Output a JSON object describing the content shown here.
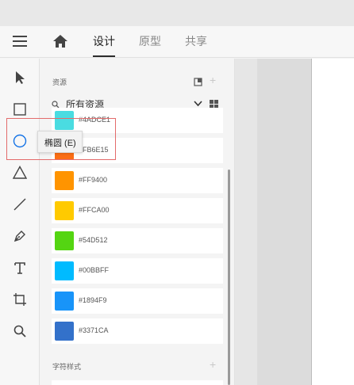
{
  "topbar": {
    "tabs": [
      {
        "label": "设计",
        "active": true
      },
      {
        "label": "原型",
        "active": false
      },
      {
        "label": "共享",
        "active": false
      }
    ]
  },
  "toolbar": {
    "tools": [
      "select-tool",
      "rectangle-tool",
      "ellipse-tool",
      "polygon-tool",
      "line-tool",
      "pen-tool",
      "text-tool",
      "artboard-tool",
      "zoom-tool"
    ],
    "active_tool": "ellipse-tool",
    "accent_color": "#1473e6"
  },
  "tooltip": {
    "text": "椭圆 (E)"
  },
  "assets_panel": {
    "title": "资源",
    "filter_label": "所有资源",
    "colors": [
      {
        "label": "#4ADCE1",
        "hex": "#4ADCE1"
      },
      {
        "label": "#FB6E15",
        "hex": "#FB6E15"
      },
      {
        "label": "#FF9400",
        "hex": "#FF9400"
      },
      {
        "label": "#FFCA00",
        "hex": "#FFCA00"
      },
      {
        "label": "#54D512",
        "hex": "#54D512"
      },
      {
        "label": "#00BBFF",
        "hex": "#00BBFF"
      },
      {
        "label": "#1894F9",
        "hex": "#1894F9"
      },
      {
        "label": "#3371CA",
        "hex": "#3371CA"
      }
    ],
    "character_styles_title": "字符样式"
  }
}
